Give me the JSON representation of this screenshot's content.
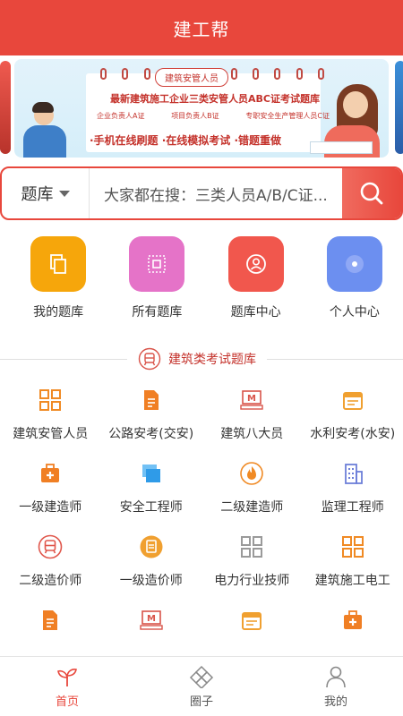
{
  "header": {
    "title": "建工帮"
  },
  "banner": {
    "pill": "建筑安管人员",
    "title": "最新建筑施工企业三类安管人员ABC证考试题库",
    "subtitles": [
      "企业负责人A证",
      "项目负责人B证",
      "专职安全生产管理人员C证"
    ],
    "features": "·手机在线刷题 ·在线模拟考试 ·错题重做"
  },
  "search": {
    "category": "题库",
    "placeholder": "大家都在搜：三类人员A/B/C证..."
  },
  "quick": [
    {
      "label": "我的题库",
      "icon": "copy-icon",
      "color": "#f6a60b"
    },
    {
      "label": "所有题库",
      "icon": "frame-icon",
      "color": "#e573c8"
    },
    {
      "label": "题库中心",
      "icon": "user-circle-icon",
      "color": "#f1574d"
    },
    {
      "label": "个人中心",
      "icon": "disc-icon",
      "color": "#6c8ff0"
    }
  ],
  "section": {
    "title": "建筑类考试题库"
  },
  "categories": [
    {
      "label": "建筑安管人员",
      "icon": "grid-icon",
      "color": "#f08a24"
    },
    {
      "label": "公路安考(交安)",
      "icon": "document-icon",
      "color": "#f07f24"
    },
    {
      "label": "建筑八大员",
      "icon": "monitor-m-icon",
      "color": "#d9544a"
    },
    {
      "label": "水利安考(水安)",
      "icon": "calendar-icon",
      "color": "#f0a030"
    },
    {
      "label": "一级建造师",
      "icon": "medkit-icon",
      "color": "#f07f24"
    },
    {
      "label": "安全工程师",
      "icon": "folders-icon",
      "color": "#2f9be8"
    },
    {
      "label": "二级建造师",
      "icon": "flame-icon",
      "color": "#f08a24"
    },
    {
      "label": "监理工程师",
      "icon": "building-icon",
      "color": "#6d7fd9"
    },
    {
      "label": "二级造价师",
      "icon": "train-icon",
      "color": "#e0574c"
    },
    {
      "label": "一级造价师",
      "icon": "receipt-icon",
      "color": "#f0a030"
    },
    {
      "label": "电力行业技师",
      "icon": "grid-gray-icon",
      "color": "#9a9a9a"
    },
    {
      "label": "建筑施工电工",
      "icon": "grid-icon",
      "color": "#f08a24"
    },
    {
      "label": "",
      "icon": "document-icon",
      "color": "#f07f24"
    },
    {
      "label": "",
      "icon": "monitor-m-icon",
      "color": "#d9544a"
    },
    {
      "label": "",
      "icon": "calendar-icon",
      "color": "#f0a030"
    },
    {
      "label": "",
      "icon": "medkit-icon",
      "color": "#f07f24"
    }
  ],
  "tabs": [
    {
      "label": "首页",
      "icon": "sprout-icon",
      "active": true
    },
    {
      "label": "圈子",
      "icon": "diamond-grid-icon",
      "active": false
    },
    {
      "label": "我的",
      "icon": "person-icon",
      "active": false
    }
  ],
  "colors": {
    "brand": "#e8473c",
    "active_tab": "#e8473c"
  }
}
